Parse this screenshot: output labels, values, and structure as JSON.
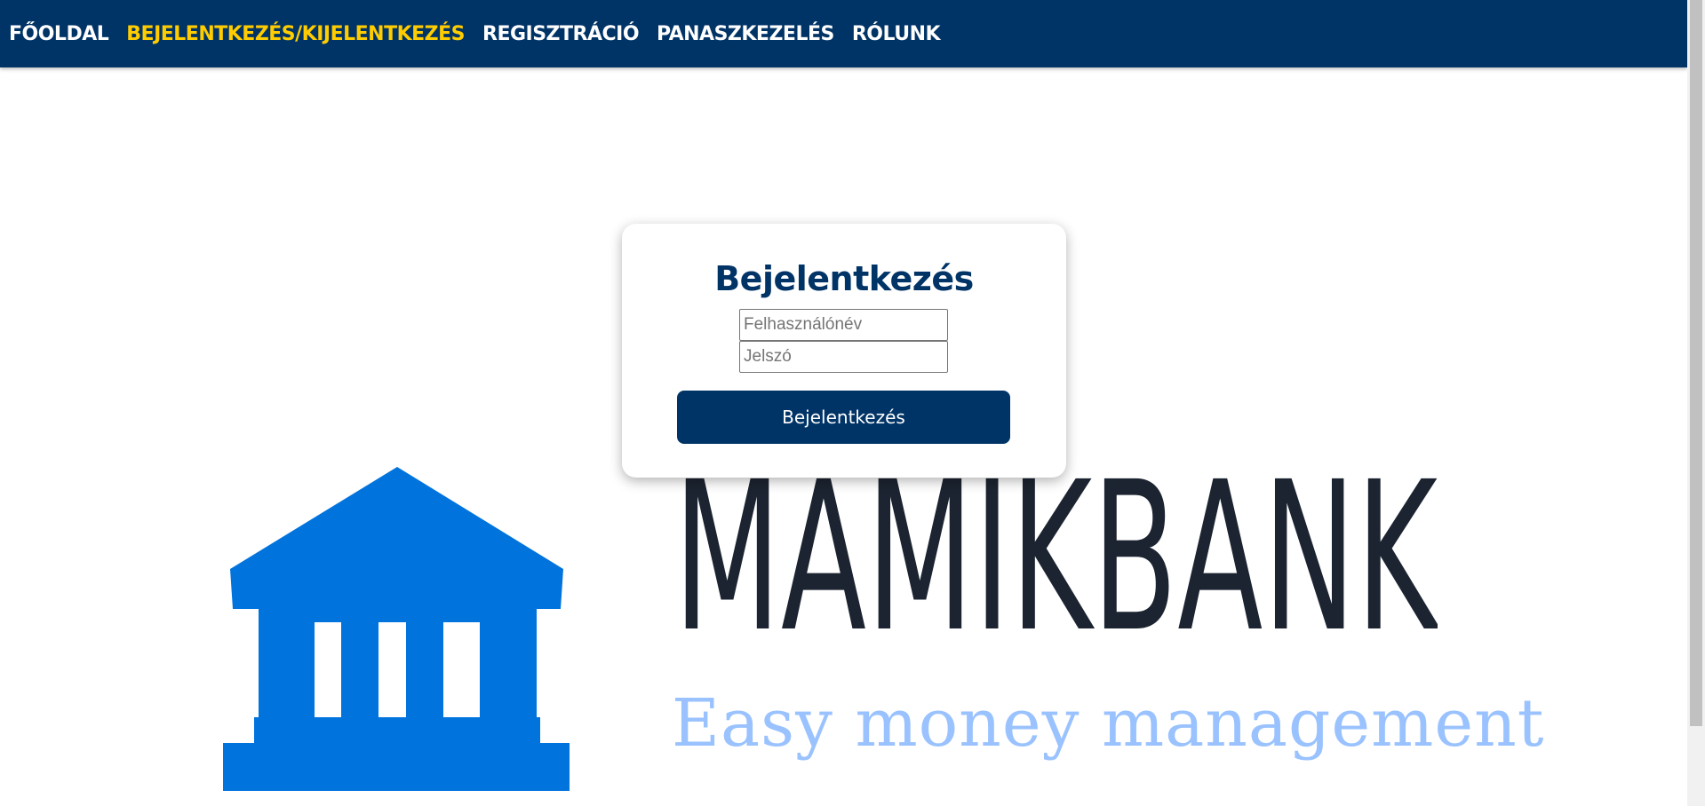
{
  "nav": {
    "items": [
      {
        "label": "FŐOLDAL",
        "active": false
      },
      {
        "label": "BEJELENTKEZÉS/KIJELENTKEZÉS",
        "active": true
      },
      {
        "label": "REGISZTRÁCIÓ",
        "active": false
      },
      {
        "label": "PANASZKEZELÉS",
        "active": false
      },
      {
        "label": "RÓLUNK",
        "active": false
      }
    ]
  },
  "login": {
    "title": "Bejelentkezés",
    "username_placeholder": "Felhasználónév",
    "username_value": "",
    "password_placeholder": "Jelszó",
    "password_value": "",
    "submit_label": "Bejelentkezés"
  },
  "hero": {
    "brand": "MAMIKBANK",
    "tagline": "Easy money management",
    "icon": "bank-building-icon"
  },
  "colors": {
    "nav_background": "#003366",
    "nav_active": "#ffcc00",
    "nav_text": "#ffffff",
    "brand_blue": "#0073dd",
    "wordmark_dark": "#1c2431",
    "tagline_light_blue": "#99c2ff",
    "button_background": "#003366"
  }
}
